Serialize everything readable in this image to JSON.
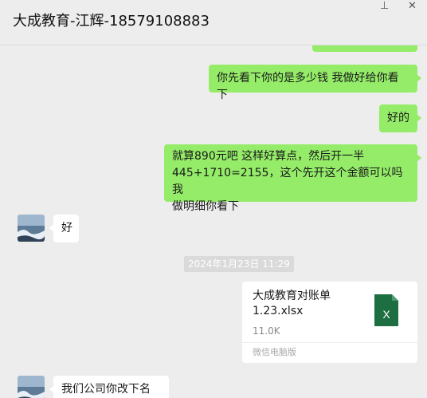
{
  "header": {
    "title": "大成教育-江辉-18579108883",
    "pin_icon": "pin-icon",
    "close_icon": "close-icon",
    "pin_glyph": "⊥",
    "close_glyph": "✕"
  },
  "messages": [
    {
      "side": "out",
      "text": ""
    },
    {
      "side": "out",
      "text": "你先看下你的是多少钱 我做好给你看下"
    },
    {
      "side": "out",
      "text": "好的"
    },
    {
      "side": "out",
      "lines": [
        "就算890元吧 这样好算点，然后开一半",
        "445+1710=2155，这个先开这个金额可以吗 我",
        "做明细你看下"
      ]
    },
    {
      "side": "in",
      "text": "好"
    },
    {
      "side": "in",
      "text": "我们公司你改下名字"
    }
  ],
  "timestamp": "2024年1月23日 11:29",
  "file": {
    "name_line1": "大成教育对账单",
    "name_line2": "1.23.xlsx",
    "size": "11.0K",
    "source": "微信电脑版",
    "icon": "excel-file-icon",
    "icon_letter": "X",
    "icon_color": "#1d6f42"
  },
  "colors": {
    "outgoing_bubble": "#95ec69",
    "incoming_bubble": "#ffffff",
    "background": "#ededed"
  }
}
